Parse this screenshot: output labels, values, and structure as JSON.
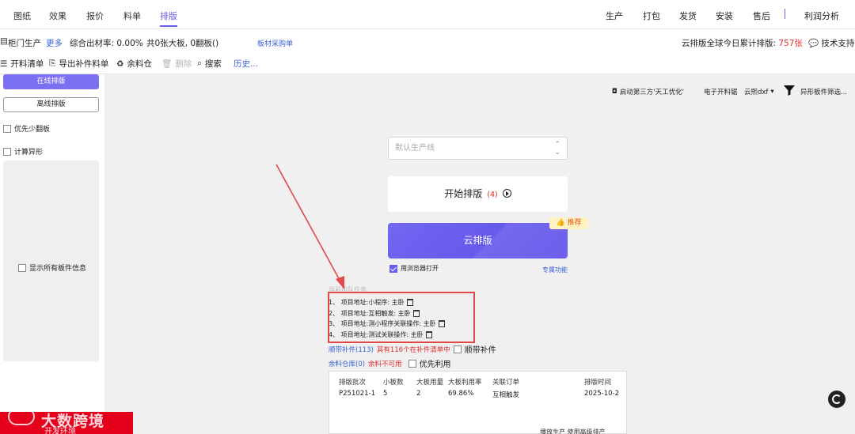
{
  "nav": {
    "tabs": [
      "图纸",
      "效果",
      "报价",
      "料单",
      "排版"
    ],
    "right_tabs": [
      "生产",
      "打包",
      "发货",
      "安装",
      "售后",
      "利润分析"
    ]
  },
  "info": {
    "module": "柜门生产",
    "more": "更多",
    "rate": "综合出材率: 0.00%",
    "boards": "共0张大板, 0翻板()",
    "purchase": "板材采购单",
    "cloud_stat_prefix": "云排版全球今日累计排版: ",
    "cloud_stat_value": "757张",
    "support": "技术支持"
  },
  "toolbar": {
    "items": [
      "开料清单",
      "导出补件料单",
      "余料仓",
      "删除",
      "搜索"
    ],
    "history": "历史..."
  },
  "left": {
    "online": "在线排版",
    "offline": "离线排版",
    "prefer_less_flip": "优先少翻板",
    "calc_shape": "计算异形",
    "show_all": "显示所有板件信息"
  },
  "right_tools": {
    "third_party": "启动第三方'天工优化'",
    "e_cut": "电子开料锯",
    "cloud_dxf": "云熙dxf",
    "shaped_filter": "异形板件筛选..."
  },
  "main": {
    "line_placeholder": "默认生产线",
    "start_label": "开始排版",
    "start_count": "(4)",
    "cloud_label": "云排版",
    "recommend": "推荐",
    "browser_open": "用浏览器打开",
    "special": "专属功能",
    "queue_title": "当前排队任务",
    "queue": [
      "1、 项目地址:小程序: 主卧",
      "2、 项目地址:互相触发: 主卧",
      "3、 项目地址:测小程序关联操作: 主卧",
      "4、 项目地址:测试关联操作: 主卧"
    ],
    "follow_parts": "顺带补件(113)",
    "follow_parts_note": "其有116个在补件清单中",
    "follow_parts_check": "顺带补件",
    "leftover": "余料仓库(0)",
    "leftover_note": "余料不可用",
    "prefer_use": "优先利用"
  },
  "table": {
    "headers": [
      "排版批次",
      "小板数",
      "大板用量",
      "大板利用率",
      "关联订单",
      "排版时间"
    ],
    "row": [
      "P251021-1",
      "5",
      "2",
      "69.86%",
      "互相触发",
      "2025-10-2"
    ]
  },
  "bottom_text": "播放生产   使用高级排产",
  "watermark": {
    "brand": "大数跨境",
    "sub": "开发环境"
  }
}
